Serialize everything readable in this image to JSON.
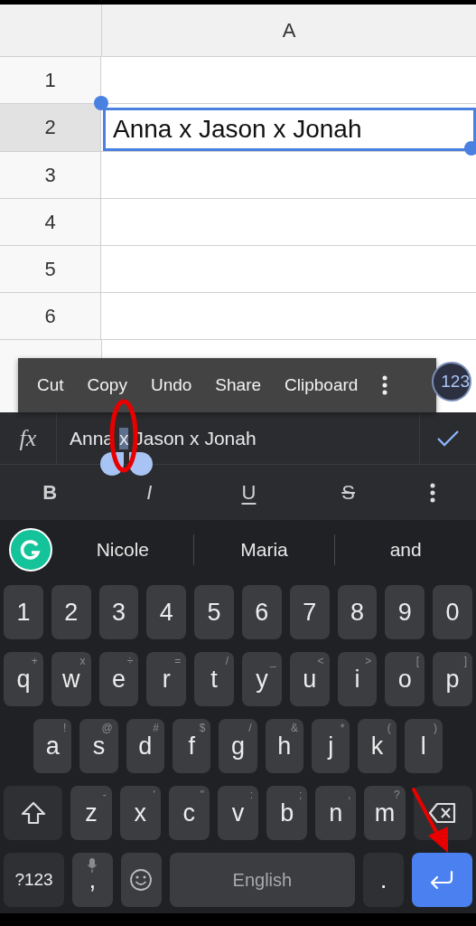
{
  "sheet": {
    "column_header": "A",
    "rows": [
      {
        "number": "1",
        "selected": false
      },
      {
        "number": "2",
        "value": "Anna x Jason x Jonah",
        "selected": true
      },
      {
        "number": "3",
        "selected": false
      },
      {
        "number": "4",
        "selected": false
      },
      {
        "number": "5",
        "selected": false
      },
      {
        "number": "6",
        "selected": false
      }
    ]
  },
  "context_menu": {
    "items": [
      "Cut",
      "Copy",
      "Undo",
      "Share",
      "Clipboard"
    ]
  },
  "floating_button": {
    "label": "123"
  },
  "formula_bar": {
    "label": "fx",
    "value_parts": [
      {
        "text": "Anna ",
        "selected": false
      },
      {
        "text": "x",
        "selected": true
      },
      {
        "text": " Jason x Jonah",
        "selected": false
      }
    ]
  },
  "format_toolbar": {
    "buttons": [
      {
        "label": "B",
        "kind": "bold"
      },
      {
        "label": "I",
        "kind": "italic"
      },
      {
        "label": "U",
        "kind": "underline"
      },
      {
        "label": "S",
        "kind": "strikethrough"
      }
    ]
  },
  "suggestions": [
    "Nicole",
    "Maria",
    "and"
  ],
  "keyboard": {
    "letter_rows": [
      [
        {
          "kind": "char",
          "label": "1"
        },
        {
          "kind": "char",
          "label": "2"
        },
        {
          "kind": "char",
          "label": "3"
        },
        {
          "kind": "char",
          "label": "4"
        },
        {
          "kind": "char",
          "label": "5"
        },
        {
          "kind": "char",
          "label": "6"
        },
        {
          "kind": "char",
          "label": "7"
        },
        {
          "kind": "char",
          "label": "8"
        },
        {
          "kind": "char",
          "label": "9"
        },
        {
          "kind": "char",
          "label": "0"
        }
      ],
      [
        {
          "kind": "char",
          "label": "q",
          "hint": "+"
        },
        {
          "kind": "char",
          "label": "w",
          "hint": "x"
        },
        {
          "kind": "char",
          "label": "e",
          "hint": "÷"
        },
        {
          "kind": "char",
          "label": "r",
          "hint": "="
        },
        {
          "kind": "char",
          "label": "t",
          "hint": "/"
        },
        {
          "kind": "char",
          "label": "y",
          "hint": "_"
        },
        {
          "kind": "char",
          "label": "u",
          "hint": "<"
        },
        {
          "kind": "char",
          "label": "i",
          "hint": ">"
        },
        {
          "kind": "char",
          "label": "o",
          "hint": "["
        },
        {
          "kind": "char",
          "label": "p",
          "hint": "]"
        }
      ],
      [
        {
          "kind": "char",
          "label": "a",
          "hint": "!"
        },
        {
          "kind": "char",
          "label": "s",
          "hint": "@"
        },
        {
          "kind": "char",
          "label": "d",
          "hint": "#"
        },
        {
          "kind": "char",
          "label": "f",
          "hint": "$"
        },
        {
          "kind": "char",
          "label": "g",
          "hint": "/"
        },
        {
          "kind": "char",
          "label": "h",
          "hint": "&"
        },
        {
          "kind": "char",
          "label": "j",
          "hint": "*"
        },
        {
          "kind": "char",
          "label": "k",
          "hint": "("
        },
        {
          "kind": "char",
          "label": "l",
          "hint": ")"
        }
      ],
      [
        {
          "kind": "shift"
        },
        {
          "kind": "char",
          "label": "z",
          "hint": "-"
        },
        {
          "kind": "char",
          "label": "x",
          "hint": "'"
        },
        {
          "kind": "char",
          "label": "c",
          "hint": "\""
        },
        {
          "kind": "char",
          "label": "v",
          "hint": ":"
        },
        {
          "kind": "char",
          "label": "b",
          "hint": ";"
        },
        {
          "kind": "char",
          "label": "n",
          "hint": ","
        },
        {
          "kind": "char",
          "label": "m",
          "hint": "?"
        },
        {
          "kind": "backspace"
        }
      ]
    ],
    "bottom_row": [
      {
        "kind": "symbols",
        "label": "?123"
      },
      {
        "kind": "comma",
        "label": ","
      },
      {
        "kind": "emoji"
      },
      {
        "kind": "space",
        "label": "English"
      },
      {
        "kind": "period",
        "label": "."
      },
      {
        "kind": "enter"
      }
    ]
  }
}
